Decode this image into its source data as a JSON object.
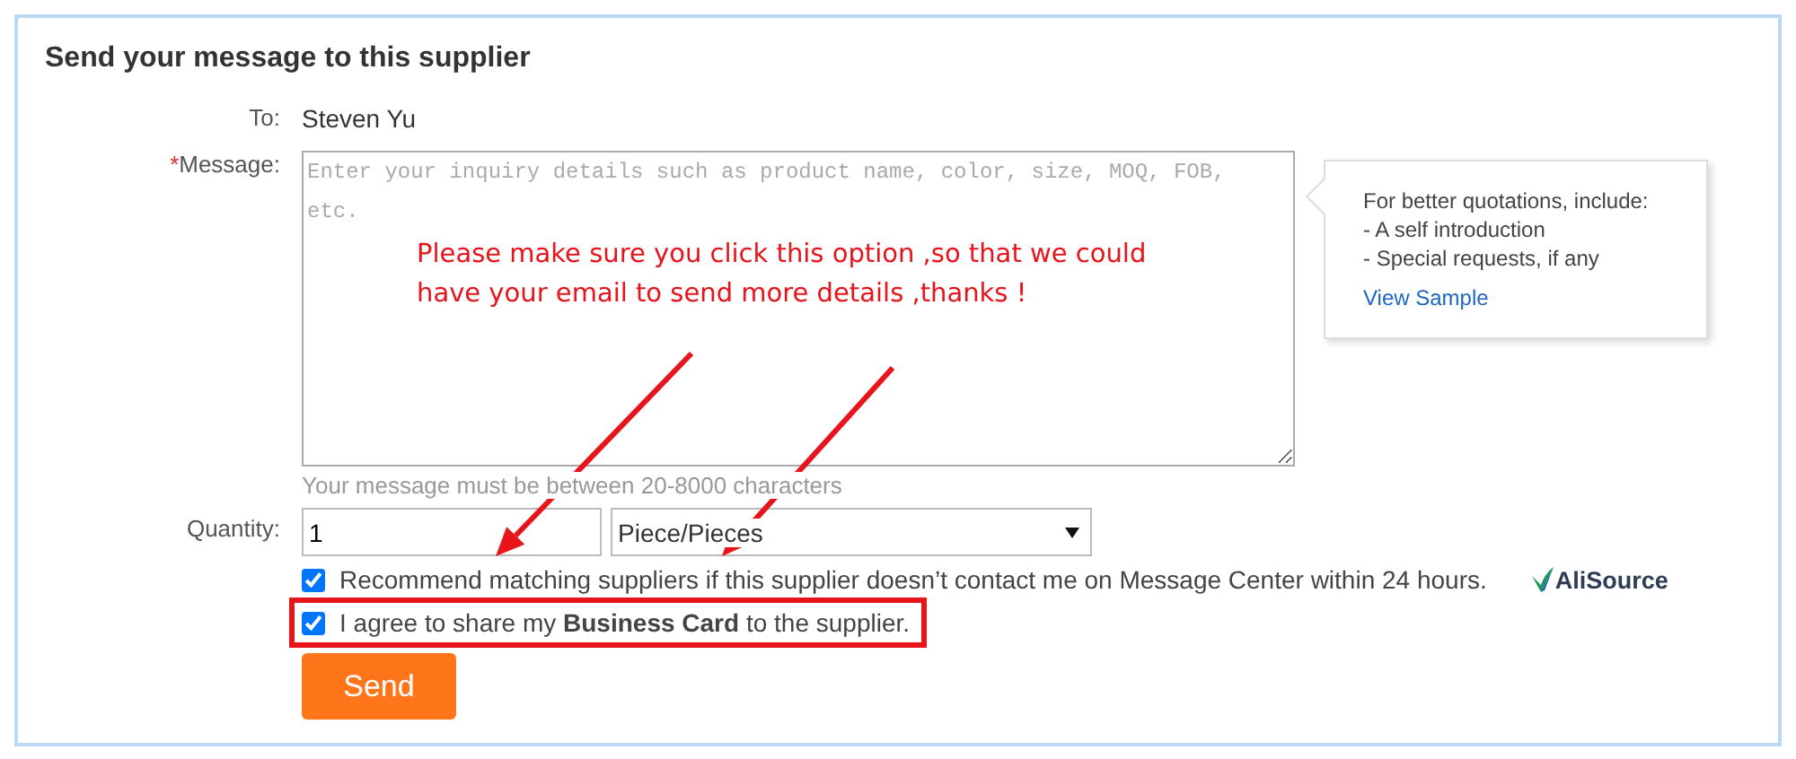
{
  "title": "Send your message to this supplier",
  "to": {
    "label": "To:",
    "value": "Steven Yu"
  },
  "message": {
    "marker": "*",
    "label": "Message:",
    "placeholder": "Enter your inquiry details such as product name, color, size, MOQ, FOB, etc."
  },
  "tip": {
    "heading": "For better quotations, include:",
    "items": [
      "- A self introduction",
      "- Special requests, if any"
    ],
    "link": "View Sample"
  },
  "hint": "Your message must be between 20-8000 characters",
  "quantity": {
    "label": "Quantity:",
    "value": "1",
    "unit": "Piece/Pieces"
  },
  "options": [
    {
      "text": "Recommend matching suppliers if this supplier doesn’t contact me on Message Center within 24 hours.",
      "checked": true,
      "highlighted": false
    },
    {
      "text": "I agree to share my **Business Card** to the supplier.",
      "checked": true,
      "highlighted": true
    }
  ],
  "brand": "AliSource",
  "send": "Send",
  "annotation": "Please make sure you click this option ,so that we could have your email to send more details ,thanks !"
}
